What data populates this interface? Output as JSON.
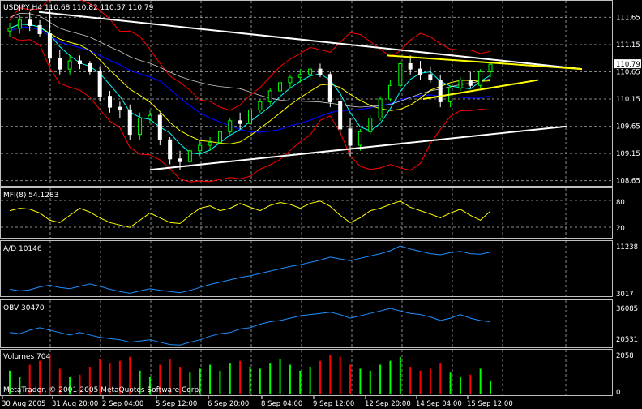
{
  "colors": {
    "background": "#000000",
    "grid": "#c0c0c0",
    "candle_up": "#00ff00",
    "candle_down": "#ffffff",
    "bb": "#ff0000",
    "ma_fast": "#00ffff",
    "ma_mid": "#ffff00",
    "ma_slow": "#0000ff",
    "ma_white": "#ffffff",
    "mfi": "#ffff00",
    "ad": "#1e90ff",
    "obv": "#1e90ff",
    "vol_up": "#00ff00",
    "vol_down": "#ff0000",
    "trend_white": "#ffffff",
    "trend_yellow": "#ffff00",
    "price_tag_bg": "#ffffff"
  },
  "main": {
    "header": "USDJPY,H4  110.68 110.82 110.57 110.79",
    "price_ticks": [
      "111.65",
      "111.15",
      "110.65",
      "110.15",
      "109.65",
      "109.15",
      "108.65"
    ],
    "current_price": "110.79"
  },
  "mfi": {
    "header": "MFI(8) 54.1283",
    "ticks": [
      "80",
      "20"
    ]
  },
  "ad": {
    "header": "A/D 10146",
    "ticks": [
      "11238",
      "3017"
    ]
  },
  "obv": {
    "header": "OBV 30470",
    "ticks": [
      "36085",
      "20531"
    ]
  },
  "volumes": {
    "header": "Volumes 704",
    "ticks": [
      "2058",
      "0"
    ],
    "footer": "MetaTrader, © 2001-2005 MetaQuotes Software Corp."
  },
  "time_axis": [
    "30 Aug 2005",
    "31 Aug 20:00",
    "2 Sep 04:00",
    "5 Sep 12:00",
    "6 Sep 20:00",
    "8 Sep 04:00",
    "9 Sep 12:00",
    "12 Sep 20:00",
    "14 Sep 04:00",
    "15 Sep 12:00"
  ],
  "chart_data": {
    "type": "candlestick",
    "symbol": "USDJPY",
    "timeframe": "H4",
    "ylim": [
      108.6,
      111.85
    ],
    "open_high_low_close": [
      [
        111.4,
        111.55,
        111.3,
        111.45
      ],
      [
        111.45,
        111.7,
        111.35,
        111.6
      ],
      [
        111.6,
        111.75,
        111.4,
        111.5
      ],
      [
        111.5,
        111.6,
        111.3,
        111.35
      ],
      [
        111.35,
        111.8,
        110.8,
        110.9
      ],
      [
        110.9,
        111.05,
        110.6,
        110.7
      ],
      [
        110.7,
        110.95,
        110.6,
        110.85
      ],
      [
        110.85,
        110.95,
        110.7,
        110.8
      ],
      [
        110.8,
        110.85,
        110.6,
        110.65
      ],
      [
        110.65,
        110.75,
        110.1,
        110.2
      ],
      [
        110.2,
        110.3,
        109.9,
        110.0
      ],
      [
        110.0,
        110.1,
        109.8,
        109.95
      ],
      [
        109.95,
        110.05,
        109.4,
        109.5
      ],
      [
        109.5,
        109.9,
        109.4,
        109.8
      ],
      [
        109.8,
        109.95,
        109.7,
        109.85
      ],
      [
        109.85,
        109.9,
        109.3,
        109.4
      ],
      [
        109.4,
        109.45,
        108.95,
        109.05
      ],
      [
        109.05,
        109.2,
        108.85,
        109.0
      ],
      [
        109.0,
        109.25,
        108.9,
        109.2
      ],
      [
        109.2,
        109.4,
        109.1,
        109.3
      ],
      [
        109.3,
        109.45,
        109.2,
        109.35
      ],
      [
        109.35,
        109.6,
        109.3,
        109.55
      ],
      [
        109.55,
        109.8,
        109.5,
        109.75
      ],
      [
        109.75,
        109.9,
        109.6,
        109.7
      ],
      [
        109.7,
        110.0,
        109.65,
        109.95
      ],
      [
        109.95,
        110.15,
        109.9,
        110.1
      ],
      [
        110.1,
        110.35,
        110.05,
        110.3
      ],
      [
        110.3,
        110.5,
        110.2,
        110.45
      ],
      [
        110.45,
        110.6,
        110.35,
        110.55
      ],
      [
        110.55,
        110.7,
        110.45,
        110.6
      ],
      [
        110.6,
        110.75,
        110.5,
        110.7
      ],
      [
        110.7,
        110.8,
        110.55,
        110.6
      ],
      [
        110.6,
        110.65,
        110.0,
        110.1
      ],
      [
        110.1,
        110.2,
        109.5,
        109.6
      ],
      [
        109.6,
        109.8,
        109.1,
        109.3
      ],
      [
        109.3,
        109.6,
        109.2,
        109.55
      ],
      [
        109.55,
        109.85,
        109.5,
        109.8
      ],
      [
        109.8,
        110.2,
        109.75,
        110.15
      ],
      [
        110.15,
        110.5,
        110.1,
        110.4
      ],
      [
        110.4,
        110.85,
        110.35,
        110.8
      ],
      [
        110.8,
        110.95,
        110.6,
        110.7
      ],
      [
        110.7,
        110.85,
        110.5,
        110.6
      ],
      [
        110.6,
        110.75,
        110.45,
        110.5
      ],
      [
        110.5,
        110.6,
        110.0,
        110.1
      ],
      [
        110.1,
        110.4,
        110.0,
        110.35
      ],
      [
        110.35,
        110.55,
        110.3,
        110.5
      ],
      [
        110.5,
        110.65,
        110.35,
        110.4
      ],
      [
        110.4,
        110.7,
        110.35,
        110.65
      ],
      [
        110.65,
        110.8,
        110.55,
        110.79
      ]
    ],
    "mfi": [
      55,
      60,
      58,
      50,
      35,
      30,
      45,
      60,
      52,
      40,
      30,
      25,
      20,
      35,
      50,
      40,
      30,
      28,
      45,
      60,
      65,
      55,
      60,
      70,
      62,
      55,
      66,
      72,
      68,
      60,
      70,
      75,
      64,
      45,
      30,
      40,
      55,
      60,
      68,
      75,
      62,
      55,
      48,
      40,
      50,
      58,
      45,
      35,
      54
    ],
    "ad": [
      3800,
      3500,
      3700,
      4200,
      4500,
      4100,
      3900,
      4300,
      4700,
      4300,
      3800,
      3400,
      3100,
      3500,
      3900,
      3600,
      3400,
      3200,
      3600,
      4100,
      4600,
      5000,
      5400,
      5800,
      6100,
      6500,
      6900,
      7300,
      7700,
      8000,
      8400,
      8800,
      9300,
      9000,
      8700,
      9100,
      9500,
      9900,
      10400,
      11238,
      10700,
      10300,
      9900,
      9700,
      10100,
      10300,
      9900,
      9800,
      10146
    ],
    "obv": [
      26000,
      25500,
      27000,
      28000,
      27000,
      26000,
      25000,
      26000,
      25000,
      24000,
      23500,
      23000,
      22000,
      22500,
      23000,
      22000,
      21000,
      20800,
      22000,
      23000,
      24500,
      25500,
      26000,
      27500,
      28000,
      29500,
      30500,
      31000,
      32000,
      33000,
      33500,
      34000,
      34500,
      33500,
      32000,
      33000,
      34000,
      35000,
      36085,
      35000,
      34000,
      33500,
      32500,
      31000,
      32000,
      33500,
      32000,
      31000,
      30470
    ],
    "volume": [
      1200,
      900,
      1500,
      1700,
      2058,
      1300,
      900,
      1000,
      1400,
      1800,
      1600,
      1700,
      1900,
      1200,
      900,
      1500,
      1800,
      1400,
      1100,
      1300,
      1500,
      1200,
      1600,
      1700,
      1400,
      1300,
      1600,
      1800,
      1500,
      1200,
      1400,
      1700,
      2000,
      1900,
      1500,
      1300,
      1200,
      1500,
      1700,
      1900,
      1400,
      1200,
      1300,
      1600,
      1100,
      900,
      1000,
      1300,
      704
    ],
    "volume_up": [
      1,
      1,
      0,
      0,
      0,
      0,
      1,
      0,
      0,
      0,
      0,
      0,
      0,
      1,
      1,
      0,
      0,
      0,
      1,
      1,
      1,
      1,
      1,
      0,
      1,
      1,
      1,
      1,
      1,
      1,
      1,
      0,
      0,
      0,
      0,
      1,
      1,
      1,
      1,
      1,
      0,
      0,
      0,
      0,
      1,
      1,
      0,
      1,
      1
    ]
  }
}
